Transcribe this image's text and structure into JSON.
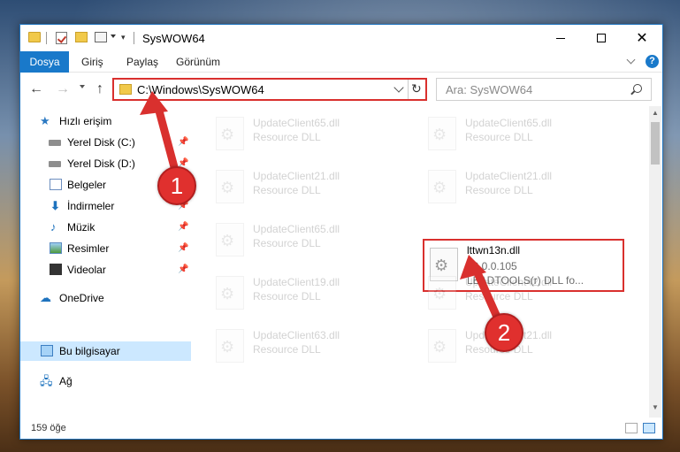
{
  "window": {
    "title": "SysWOW64"
  },
  "ribbon": {
    "tabs": [
      {
        "label": "Dosya"
      },
      {
        "label": "Giriş"
      },
      {
        "label": "Paylaş"
      },
      {
        "label": "Görünüm"
      }
    ],
    "help_label": "?"
  },
  "navbar": {
    "address": "C:\\Windows\\SysWOW64",
    "search_placeholder": "Ara: SysWOW64"
  },
  "sidebar": {
    "items": [
      {
        "label": "Hızlı erişim",
        "icon": "star-icon"
      },
      {
        "label": "Yerel Disk (C:)",
        "icon": "disk-icon",
        "pinned": true
      },
      {
        "label": "Yerel Disk (D:)",
        "icon": "disk-icon",
        "pinned": true
      },
      {
        "label": "Belgeler",
        "icon": "documents-icon",
        "pinned": true
      },
      {
        "label": "İndirmeler",
        "icon": "download-icon",
        "pinned": true
      },
      {
        "label": "Müzik",
        "icon": "music-icon",
        "pinned": true
      },
      {
        "label": "Resimler",
        "icon": "pictures-icon",
        "pinned": true
      },
      {
        "label": "Videolar",
        "icon": "videos-icon",
        "pinned": true
      },
      {
        "label": "OneDrive",
        "icon": "cloud-icon"
      },
      {
        "label": "Bu bilgisayar",
        "icon": "computer-icon",
        "selected": true
      },
      {
        "label": "Ağ",
        "icon": "network-icon"
      }
    ]
  },
  "files": [
    {
      "name": "UpdateClient65.dll",
      "desc": "Resource DLL"
    },
    {
      "name": "UpdateClient65.dll",
      "desc": "Resource DLL"
    },
    {
      "name": "UpdateClient21.dll",
      "desc": "Resource DLL"
    },
    {
      "name": "UpdateClient21.dll",
      "desc": "Resource DLL"
    },
    {
      "name": "UpdateClient65.dll",
      "desc": "Resource DLL"
    },
    {
      "name": "lttwn13n.dll",
      "version": "13.0.0.105",
      "desc": "LEADTOOLS(r) DLL fo...",
      "highlighted": true
    },
    {
      "name": "UpdateClient19.dll",
      "desc": "Resource DLL"
    },
    {
      "name": "UpdateClient42.dll",
      "desc": "Resource DLL"
    },
    {
      "name": "UpdateClient63.dll",
      "desc": "Resource DLL"
    },
    {
      "name": "UpdateClient21.dll",
      "desc": "Resource DLL"
    }
  ],
  "status": {
    "count": "159 öğe"
  },
  "annotations": [
    {
      "label": "1"
    },
    {
      "label": "2"
    }
  ],
  "colors": {
    "accent": "#1979ca",
    "highlight_border": "#d9302e",
    "selection": "#cce8ff"
  }
}
